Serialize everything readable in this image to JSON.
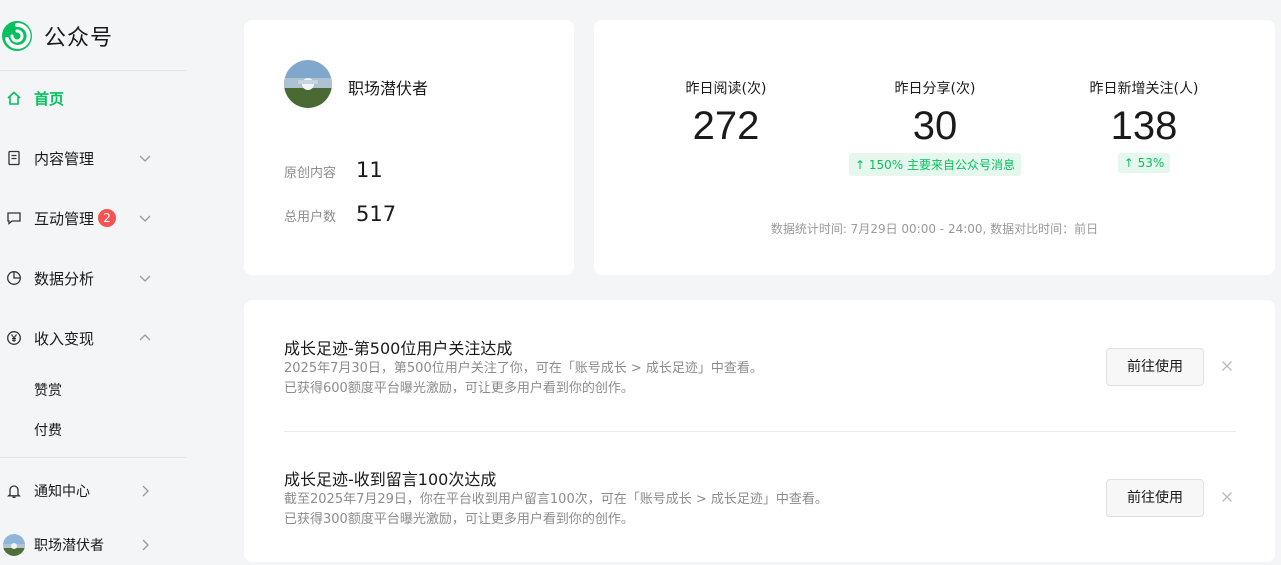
{
  "app": {
    "title": "公众号"
  },
  "sidebar": {
    "items": [
      {
        "label": "首页",
        "icon": "home-icon"
      },
      {
        "label": "内容管理",
        "icon": "document-icon"
      },
      {
        "label": "互动管理",
        "icon": "comment-icon",
        "badge": "2"
      },
      {
        "label": "数据分析",
        "icon": "pie-chart-icon"
      },
      {
        "label": "收入变现",
        "icon": "yen-icon"
      }
    ],
    "sub_items": [
      {
        "label": "赞赏"
      },
      {
        "label": "付费"
      }
    ],
    "notifications": {
      "label": "通知中心",
      "icon": "bell-icon"
    },
    "account": {
      "label": "职场潜伏者"
    }
  },
  "profile": {
    "name": "职场潜伏者",
    "original_label": "原创内容",
    "original_value": "11",
    "users_label": "总用户数",
    "users_value": "517"
  },
  "stats": {
    "reads": {
      "label": "昨日阅读(次)",
      "value": "272"
    },
    "shares": {
      "label": "昨日分享(次)",
      "value": "30",
      "trend": "↑ 150%   主要来自公众号消息"
    },
    "follows": {
      "label": "昨日新增关注(人)",
      "value": "138",
      "trend": "↑ 53%"
    },
    "footnote": "数据统计时间: 7月29日 00:00 - 24:00, 数据对比时间：前日"
  },
  "tasks": [
    {
      "title": "成长足迹-第500位用户关注达成",
      "line1": "2025年7月30日，第500位用户关注了你，可在「账号成长 > 成长足迹」中查看。",
      "line2": "已获得600额度平台曝光激励，可让更多用户看到你的创作。",
      "button": "前往使用"
    },
    {
      "title": "成长足迹-收到留言100次达成",
      "line1": "截至2025年7月29日，你在平台收到用户留言100次，可在「账号成长 > 成长足迹」中查看。",
      "line2": "已获得300额度平台曝光激励，可让更多用户看到你的创作。",
      "button": "前往使用"
    }
  ],
  "colors": {
    "brand": "#07c160",
    "badge": "#fa5151"
  }
}
